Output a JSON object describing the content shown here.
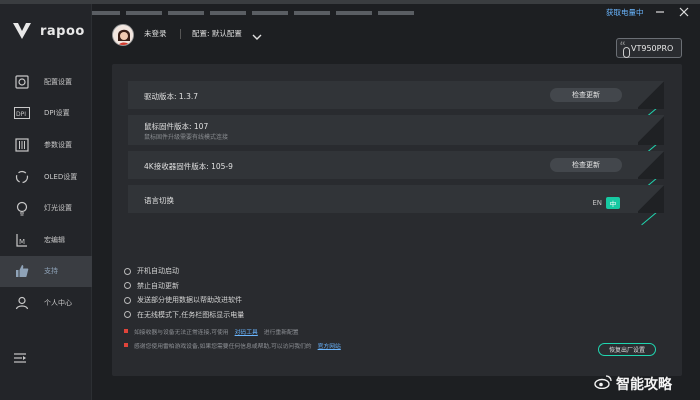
{
  "brand": {
    "name": "rapoo",
    "logo_icon": "v-logo-icon",
    "accent": "#1fd6b0"
  },
  "header": {
    "user": "未登录",
    "config": "配置: 默认配置",
    "firmware_link": "获取电量中",
    "device": "VT950PRO",
    "device_tag": "4K"
  },
  "sidebar": {
    "items": [
      {
        "label": "配置设置",
        "icon": "profile-icon"
      },
      {
        "label": "DPI设置",
        "icon": "dpi-icon"
      },
      {
        "label": "参数设置",
        "icon": "parameter-icon"
      },
      {
        "label": "OLED设置",
        "icon": "oled-icon"
      },
      {
        "label": "灯光设置",
        "icon": "bulb-icon"
      },
      {
        "label": "宏编辑",
        "icon": "macro-icon"
      },
      {
        "label": "支持",
        "icon": "thumbs-up-icon",
        "active": true
      },
      {
        "label": "个人中心",
        "icon": "user-icon"
      }
    ],
    "menu_icon": "collapse-menu-icon"
  },
  "main": {
    "driver": {
      "label": "驱动版本: 1.3.7",
      "button": "检查更新"
    },
    "mouse_fw": {
      "label": "鼠标固件版本: 107",
      "sub": "鼠标固件升级需要有线模式连接"
    },
    "receiver_fw": {
      "label": "4K接收器固件版本: 105-9",
      "button": "检查更新"
    },
    "language": {
      "label": "语言切换",
      "en": "EN",
      "zh": "中"
    },
    "options": [
      "开机自动启动",
      "禁止自动更新",
      "发送部分使用数据以帮助改进软件",
      "在无线模式下,任务栏图标显示电量"
    ],
    "notes": [
      {
        "text": "如接收器与设备无法正常连接,可使用",
        "link": "对码工具",
        "after": "进行重新配置"
      },
      {
        "text": "感谢您使用雷柏游戏设备,如果您需要任何信息或帮助,可以访问我们的",
        "link": "官方网站",
        "after": ""
      }
    ],
    "reset": "恢复出厂设置"
  },
  "watermark": "智能攻略"
}
